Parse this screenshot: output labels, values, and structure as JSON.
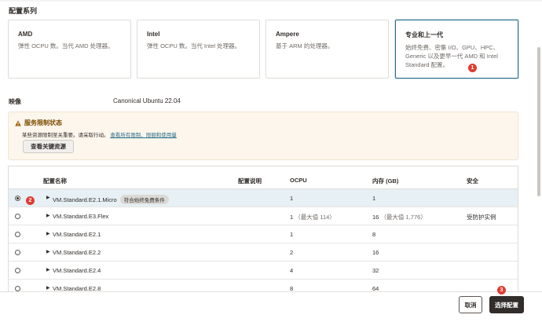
{
  "section_title": "配置系列",
  "cards": [
    {
      "title": "AMD",
      "desc": "弹性 OCPU 数。当代 AMD 处理器。"
    },
    {
      "title": "Intel",
      "desc": "弹性 OCPU 数。当代 Intel 处理器。"
    },
    {
      "title": "Ampere",
      "desc": "基于 ARM 的处理器。"
    },
    {
      "title": "专业和上一代",
      "desc_line1": "始终免费、密集 I/O、GPU、HPC、",
      "desc_line2": "Generic 以及更早一代 AMD 和 Intel",
      "desc_line3": "Standard 配置。"
    }
  ],
  "image": {
    "label": "映像",
    "value": "Canonical Ubuntu 22.04"
  },
  "alert": {
    "title": "服务限制状态",
    "body": "某些资源限制至关重要。请采取行动。",
    "link": "查看所有限制、限额和使用量",
    "button": "查看关键资源"
  },
  "table": {
    "headers": {
      "name": "配置名称",
      "desc": "配置说明",
      "ocpu": "OCPU",
      "memory": "内存 (GB)",
      "security": "安全"
    },
    "rows": [
      {
        "name": "VM.Standard.E2.1.Micro",
        "tag": "符合始终免费条件",
        "ocpu": "1",
        "ocpu_extra": "",
        "memory": "1",
        "memory_extra": "",
        "security": ""
      },
      {
        "name": "VM.Standard.E3.Flex",
        "tag": "",
        "ocpu": "1",
        "ocpu_extra": "（最大值 114）",
        "memory": "16",
        "memory_extra": "（最大值 1,776）",
        "security": "受防护实例"
      },
      {
        "name": "VM.Standard.E2.1",
        "tag": "",
        "ocpu": "1",
        "ocpu_extra": "",
        "memory": "8",
        "memory_extra": "",
        "security": ""
      },
      {
        "name": "VM.Standard.E2.2",
        "tag": "",
        "ocpu": "2",
        "ocpu_extra": "",
        "memory": "16",
        "memory_extra": "",
        "security": ""
      },
      {
        "name": "VM.Standard.E2.4",
        "tag": "",
        "ocpu": "4",
        "ocpu_extra": "",
        "memory": "32",
        "memory_extra": "",
        "security": ""
      },
      {
        "name": "VM.Standard.E2.8",
        "tag": "",
        "ocpu": "8",
        "ocpu_extra": "",
        "memory": "64",
        "memory_extra": "",
        "security": ""
      }
    ]
  },
  "badges": {
    "one": "1",
    "two": "2",
    "three": "3"
  },
  "footer": {
    "cancel": "取消",
    "select": "选择配置"
  },
  "colors": {
    "accent": "#2d6e8a",
    "badge": "#e03c31",
    "primary_button": "#312d2a",
    "selected_row": "#e6f0f5",
    "alert_bg": "#fcf6ec"
  }
}
